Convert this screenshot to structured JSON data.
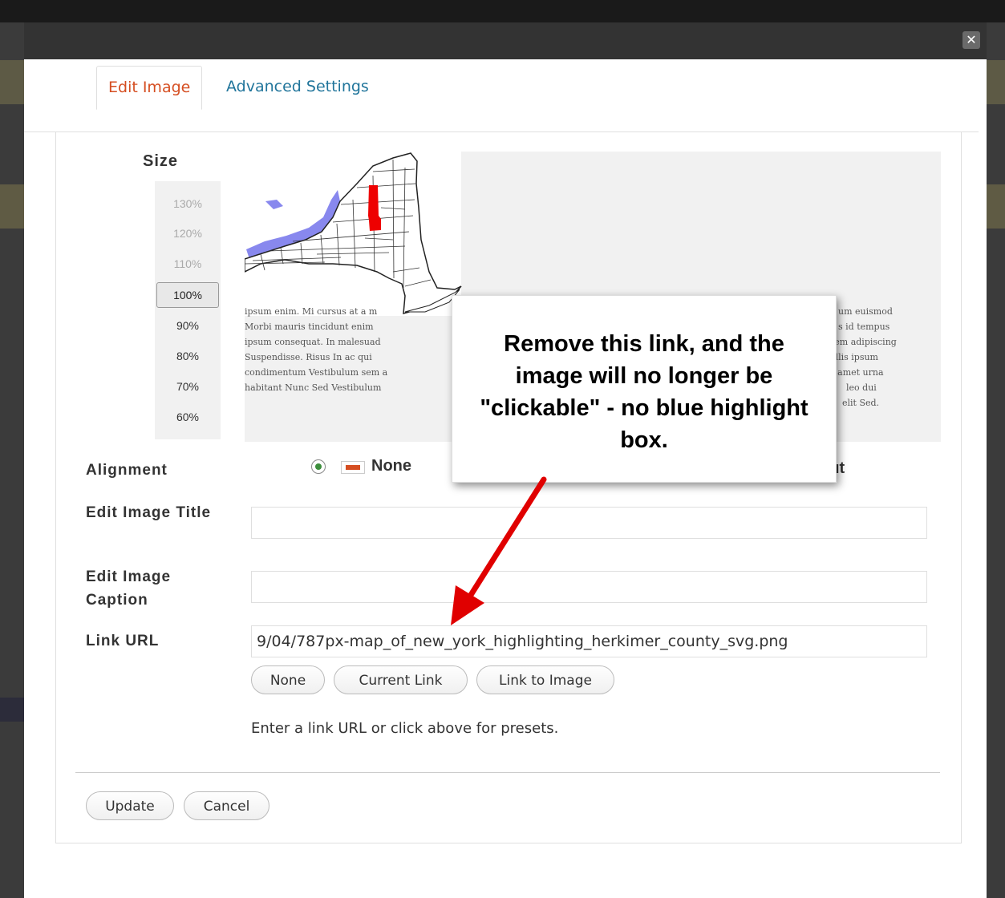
{
  "modal": {
    "close_label": "✕",
    "tabs": [
      {
        "label": "Edit Image"
      },
      {
        "label": "Advanced Settings"
      }
    ]
  },
  "size": {
    "title": "Size",
    "options": [
      "130%",
      "120%",
      "110%",
      "100%",
      "90%",
      "80%",
      "70%",
      "60%"
    ],
    "selected": "100%"
  },
  "preview": {
    "lorem_lines": [
      "ipsum enim. Mi cursus at a m",
      "Morbi mauris tincidunt enim",
      "ipsum consequat. In malesuad",
      "Suspendisse. Risus In ac qui",
      "condimentum Vestibulum sem a",
      "habitant Nunc Sed Vestibulum"
    ],
    "lorem_right": [
      "um euismod",
      "s id tempus",
      "rem adipiscing",
      "allis ipsum",
      "s amet urna",
      "leo dui",
      "elit Sed."
    ]
  },
  "callout": {
    "text": "Remove this link, and the image will no longer be \"clickable\" - no blue highlight box."
  },
  "form": {
    "alignment_label": "Alignment",
    "alignment_none": "None",
    "alignment_right_fragment": "ıt",
    "title_label": "Edit Image Title",
    "title_value": "",
    "caption_label": "Edit Image Caption",
    "caption_value": "",
    "link_label": "Link URL",
    "link_value": "9/04/787px-map_of_new_york_highlighting_herkimer_county_svg.png",
    "link_buttons": {
      "none": "None",
      "current": "Current Link",
      "image": "Link to Image"
    },
    "help_text": "Enter a link URL or click above for presets."
  },
  "actions": {
    "update": "Update",
    "cancel": "Cancel"
  },
  "colors": {
    "accent_tab": "#d54e21",
    "link_tab": "#21759b",
    "highlight_county": "#ee0000",
    "lake": "#8888ee",
    "arrow": "#e00000"
  }
}
